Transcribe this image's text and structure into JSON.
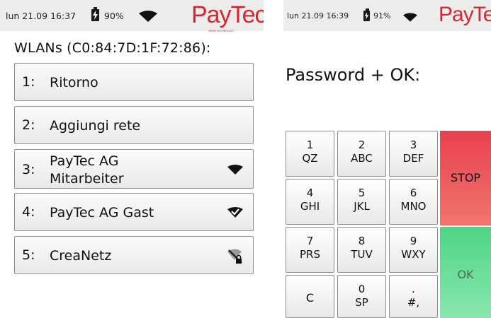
{
  "left": {
    "status": {
      "time": "lun 21.09 16:37",
      "battery": "90%"
    },
    "logo": "PayTec",
    "logo_tag": "SWISS TECHNOLOGY",
    "title": "WLANs (C0:84:7D:1F:72:86):",
    "items": [
      {
        "num": "1:",
        "label": "Ritorno",
        "icon": ""
      },
      {
        "num": "2:",
        "label": "Aggiungi rete",
        "icon": ""
      },
      {
        "num": "3:",
        "label_line1": "PayTec AG",
        "label_line2": "Mitarbeiter",
        "icon": "wifi-signal-icon"
      },
      {
        "num": "4:",
        "label": "PayTec AG Gast",
        "icon": "wifi-connected-check-icon"
      },
      {
        "num": "5:",
        "label": "CreaNetz",
        "icon": "wifi-locked-icon"
      }
    ]
  },
  "right": {
    "status": {
      "time": "lun 21.09 16:39",
      "battery": "91%"
    },
    "logo": "PayTec",
    "prompt": "Password + OK:",
    "keys": [
      {
        "top": "1",
        "bottom": "QZ"
      },
      {
        "top": "2",
        "bottom": "ABC"
      },
      {
        "top": "3",
        "bottom": "DEF"
      },
      {
        "top": "4",
        "bottom": "GHI"
      },
      {
        "top": "5",
        "bottom": "JKL"
      },
      {
        "top": "6",
        "bottom": "MNO"
      },
      {
        "top": "7",
        "bottom": "PRS"
      },
      {
        "top": "8",
        "bottom": "TUV"
      },
      {
        "top": "9",
        "bottom": "WXY"
      },
      {
        "single": "C"
      },
      {
        "top": "0",
        "bottom": "SP"
      },
      {
        "top": ".",
        "bottom": "#,"
      }
    ],
    "stop": "STOP",
    "ok": "OK"
  },
  "colors": {
    "brand": "#d8252e",
    "stop": "#e9414f",
    "ok": "#4ed585",
    "statusbar": "#ececec"
  }
}
